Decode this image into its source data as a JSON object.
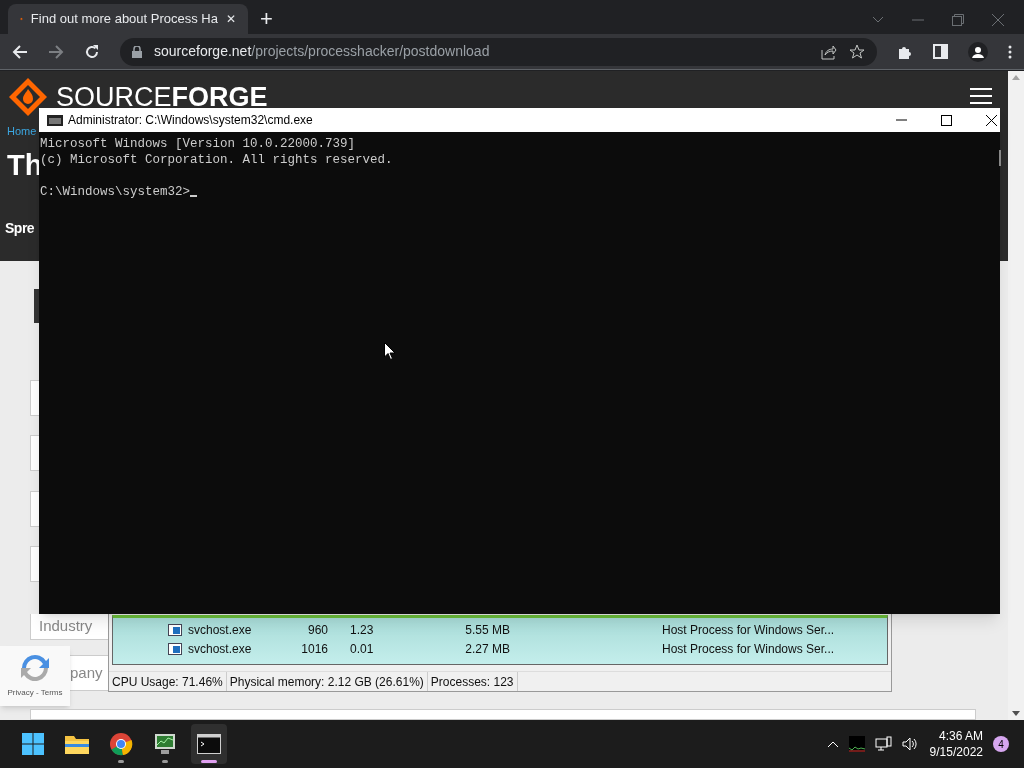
{
  "browser": {
    "tab": {
      "title": "Find out more about Process Ha",
      "close": "✕"
    },
    "new_tab": "+",
    "address": {
      "domain": "sourceforge.net",
      "path": "/projects/processhacker/postdownload"
    }
  },
  "page": {
    "logo": {
      "light": "SOURCE",
      "bold": "FORGE"
    },
    "breadcrumb": "Home",
    "heading": "Th",
    "subheading": "Spre",
    "fields": [
      {
        "label": "Industry"
      },
      {
        "label": "pany"
      }
    ],
    "recaptcha": {
      "links": "Privacy - Terms"
    }
  },
  "cmd": {
    "title": "Administrator: C:\\Windows\\system32\\cmd.exe",
    "lines": [
      "Microsoft Windows [Version 10.0.22000.739]",
      "(c) Microsoft Corporation. All rights reserved."
    ],
    "prompt": "C:\\Windows\\system32>"
  },
  "process_hacker": {
    "rows": [
      {
        "name": "svchost.exe",
        "pid": "960",
        "cpu": "1.23",
        "memory": "5.55 MB",
        "description": "Host Process for Windows Ser..."
      },
      {
        "name": "svchost.exe",
        "pid": "1016",
        "cpu": "0.01",
        "memory": "2.27 MB",
        "description": "Host Process for Windows Ser..."
      }
    ],
    "status_bar": [
      "CPU Usage: 71.46%",
      "Physical memory: 2.12 GB (26.61%)",
      "Processes: 123"
    ]
  },
  "taskbar": {
    "apps": [
      {
        "kind": "start",
        "running": false,
        "active": false
      },
      {
        "kind": "explorer",
        "running": false,
        "active": false
      },
      {
        "kind": "chrome",
        "running": true,
        "active": false
      },
      {
        "kind": "processhacker",
        "running": true,
        "active": false
      },
      {
        "kind": "terminal",
        "running": true,
        "active": true
      }
    ],
    "time": "4:36 AM",
    "date": "9/15/2022",
    "notifications": "4"
  }
}
